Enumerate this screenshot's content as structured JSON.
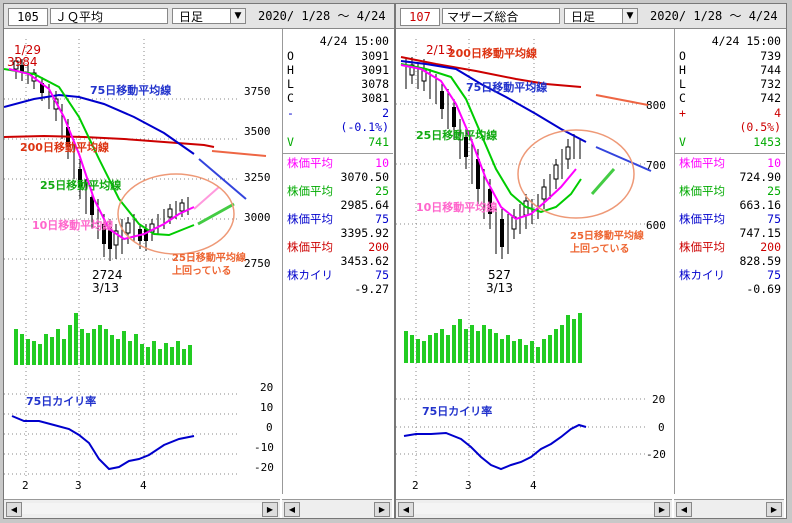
{
  "left": {
    "code": "105",
    "name": "ＪＱ平均",
    "period": "日足",
    "range": "2020/ 1/28 ～  4/24",
    "price_ticks": [
      "3750",
      "3500",
      "3250",
      "3000",
      "2750"
    ],
    "kairi_ticks": [
      "20",
      "10",
      "0",
      "-10",
      "-20"
    ],
    "month_labels": [
      "2",
      "3",
      "4"
    ],
    "high_label": {
      "date": "1/29",
      "value": "3984"
    },
    "low_label": {
      "value": "2724",
      "date": "3/13"
    },
    "ma_labels": {
      "ma75": "75日移動平均線",
      "ma200": "200日移動平均線",
      "ma25": "25日移動平均線",
      "ma10": "10日移動平均線",
      "cross": "25日移動平均線",
      "cross2": "上回っている"
    },
    "kairi_title": "75日カイリ率",
    "info": {
      "time": "4/24 15:00",
      "ohlc": [
        {
          "k": "O",
          "v": "3091"
        },
        {
          "k": "H",
          "v": "3091"
        },
        {
          "k": "L",
          "v": "3078"
        },
        {
          "k": "C",
          "v": "3081"
        }
      ],
      "chg": {
        "k": "-",
        "v": "2"
      },
      "pct": "(-0.1%)",
      "vol": {
        "k": "V",
        "v": "741"
      },
      "mas": [
        {
          "label": "株価平均",
          "n": "10",
          "v": "3070.50",
          "color": "#ff00ff"
        },
        {
          "label": "株価平均",
          "n": "25",
          "v": "2985.64",
          "color": "#00aa00"
        },
        {
          "label": "株価平均",
          "n": "75",
          "v": "3395.92",
          "color": "#0000cc"
        },
        {
          "label": "株価平均",
          "n": "200",
          "v": "3453.62",
          "color": "#cc0000"
        }
      ],
      "kairi": {
        "label": "株カイリ",
        "n": "75",
        "v": "-9.27"
      }
    }
  },
  "right": {
    "code": "107",
    "name": "マザーズ総合",
    "period": "日足",
    "range": "2020/ 1/28 ～  4/24",
    "price_ticks": [
      "800",
      "700",
      "600"
    ],
    "kairi_ticks": [
      "20",
      "0",
      "-20"
    ],
    "month_labels": [
      "2",
      "3",
      "4"
    ],
    "high_label": {
      "date": "2/13"
    },
    "low_label": {
      "value": "527",
      "date": "3/13"
    },
    "ma_labels": {
      "ma75": "75日移動平均線",
      "ma200": "200日移動平均線",
      "ma25": "25日移動平均線",
      "ma10": "10日移動平均線",
      "cross": "25日移動平均線",
      "cross2": "上回っている"
    },
    "kairi_title": "75日カイリ率",
    "info": {
      "time": "4/24 15:00",
      "ohlc": [
        {
          "k": "O",
          "v": "739"
        },
        {
          "k": "H",
          "v": "744"
        },
        {
          "k": "L",
          "v": "732"
        },
        {
          "k": "C",
          "v": "742"
        }
      ],
      "chg": {
        "k": "+",
        "v": "4"
      },
      "pct": "(0.5%)",
      "vol": {
        "k": "V",
        "v": "1453"
      },
      "mas": [
        {
          "label": "株価平均",
          "n": "10",
          "v": "724.90",
          "color": "#ff00ff"
        },
        {
          "label": "株価平均",
          "n": "25",
          "v": "663.16",
          "color": "#00aa00"
        },
        {
          "label": "株価平均",
          "n": "75",
          "v": "747.15",
          "color": "#0000cc"
        },
        {
          "label": "株価平均",
          "n": "200",
          "v": "828.59",
          "color": "#cc0000"
        }
      ],
      "kairi": {
        "label": "株カイリ",
        "n": "75",
        "v": "-0.69"
      }
    }
  }
}
